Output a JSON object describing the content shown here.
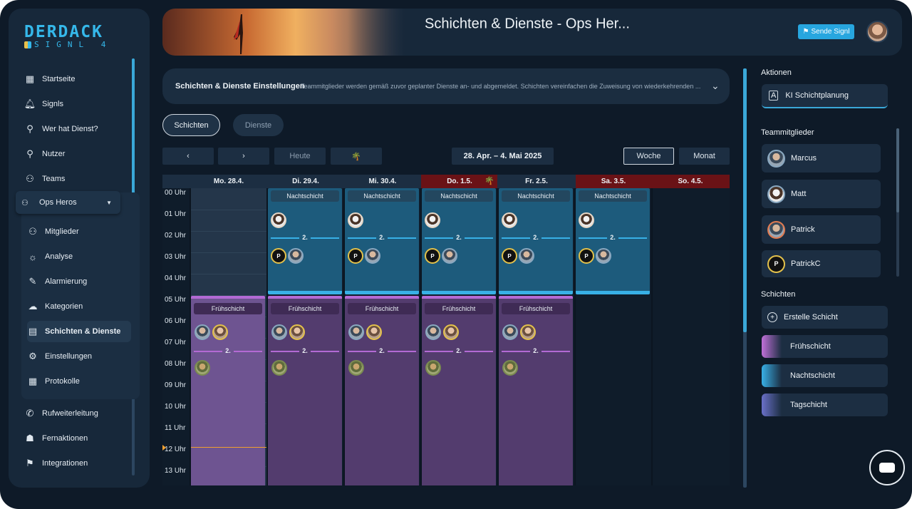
{
  "brand": {
    "line1": "DERDACK",
    "line2": "SIGNL 4"
  },
  "sidebar": {
    "items": [
      {
        "label": "Startseite",
        "icon": "grid-icon"
      },
      {
        "label": "Signls",
        "icon": "bell-icon"
      },
      {
        "label": "Wer hat Dienst?",
        "icon": "user-icon"
      },
      {
        "label": "Nutzer",
        "icon": "user-icon"
      },
      {
        "label": "Teams",
        "icon": "teams-icon"
      }
    ],
    "team_dropdown": "Ops Heros",
    "sub_items": [
      {
        "label": "Mitglieder",
        "icon": "members-icon"
      },
      {
        "label": "Analyse",
        "icon": "bulb-icon"
      },
      {
        "label": "Alarmierung",
        "icon": "wrench-icon"
      },
      {
        "label": "Kategorien",
        "icon": "categories-icon"
      },
      {
        "label": "Schichten & Dienste",
        "icon": "calendar-icon"
      },
      {
        "label": "Einstellungen",
        "icon": "gear-icon"
      },
      {
        "label": "Protokolle",
        "icon": "log-icon"
      }
    ],
    "bottom_items": [
      {
        "label": "Rufweiterleitung",
        "icon": "phone-icon"
      },
      {
        "label": "Fernaktionen",
        "icon": "remote-icon"
      },
      {
        "label": "Integrationen",
        "icon": "signpost-icon"
      }
    ]
  },
  "header": {
    "title": "Schichten & Dienste - Ops Her...",
    "send_button": "Sende Signl"
  },
  "settings_bar": {
    "title": "Schichten & Dienste Einstellungen",
    "description": "Teammitglieder werden gemäß zuvor geplanter Dienste an- und abgemeldet. Schichten vereinfachen die Zuweisung von wiederkehrenden ..."
  },
  "tabs": {
    "shifts": "Schichten",
    "duties": "Dienste"
  },
  "toolbar": {
    "prev": "‹",
    "next": "›",
    "today": "Heute",
    "range": "28. Apr. – 4. Mai 2025",
    "week": "Woche",
    "month": "Monat"
  },
  "calendar": {
    "days": [
      "Mo. 28.4.",
      "Di. 29.4.",
      "Mi. 30.4.",
      "Do. 1.5.",
      "Fr. 2.5.",
      "Sa. 3.5.",
      "So. 4.5."
    ],
    "hours": [
      "00 Uhr",
      "01 Uhr",
      "02 Uhr",
      "03 Uhr",
      "04 Uhr",
      "05 Uhr",
      "06 Uhr",
      "07 Uhr",
      "08 Uhr",
      "09 Uhr",
      "10 Uhr",
      "11 Uhr",
      "12 Uhr",
      "13 Uhr"
    ],
    "night_label": "Nachtschicht",
    "early_label": "Frühschicht",
    "rank_label": "2.",
    "badge_letter": "P"
  },
  "right_panel": {
    "actions_title": "Aktionen",
    "ai_button": "KI Schichtplanung",
    "members_title": "Teammitglieder",
    "members": [
      "Marcus",
      "Matt",
      "Patrick",
      "PatrickC"
    ],
    "shifts_title": "Schichten",
    "create_shift": "Erstelle Schicht",
    "shift_types": [
      {
        "label": "Frühschicht",
        "color": "#c070d8"
      },
      {
        "label": "Nachtschicht",
        "color": "#38b0e6"
      },
      {
        "label": "Tagschicht",
        "color": "#6a70c8"
      }
    ]
  }
}
